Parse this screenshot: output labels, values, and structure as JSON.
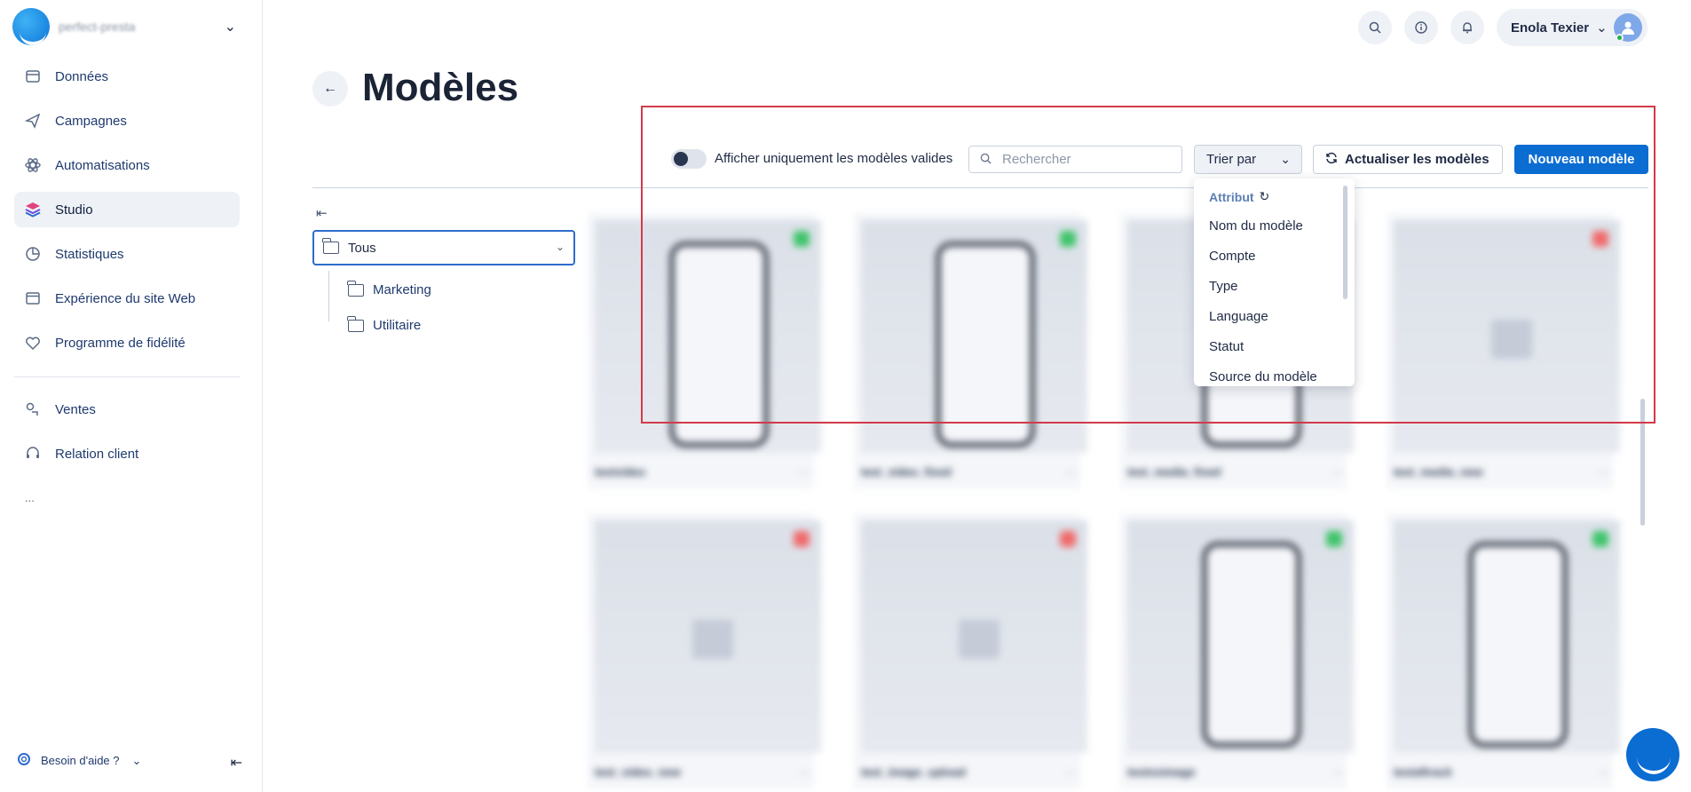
{
  "sidebar": {
    "brand_name": "perfect-presta",
    "items": [
      {
        "label": "Données",
        "icon": "database-icon"
      },
      {
        "label": "Campagnes",
        "icon": "paper-plane-icon"
      },
      {
        "label": "Automatisations",
        "icon": "atom-icon"
      },
      {
        "label": "Studio",
        "icon": "layers-icon",
        "active": true
      },
      {
        "label": "Statistiques",
        "icon": "pie-chart-icon"
      },
      {
        "label": "Expérience du site Web",
        "icon": "browser-window-icon"
      },
      {
        "label": "Programme de fidélité",
        "icon": "heart-tag-icon"
      },
      {
        "label": "Ventes",
        "icon": "sales-icon"
      },
      {
        "label": "Relation client",
        "icon": "headset-icon"
      }
    ],
    "more": "...",
    "help_label": "Besoin d'aide ?"
  },
  "header": {
    "user_name": "Enola Texier"
  },
  "page": {
    "title": "Modèles"
  },
  "toolbar": {
    "toggle_label": "Afficher uniquement les modèles valides",
    "toggle_on": false,
    "search_placeholder": "Rechercher",
    "search_value": "",
    "sort_label": "Trier par",
    "refresh_label": "Actualiser les modèles",
    "new_label": "Nouveau modèle"
  },
  "sort_dropdown": {
    "header": "Attribut",
    "options": [
      "Nom du modèle",
      "Compte",
      "Type",
      "Language",
      "Statut",
      "Source du modèle"
    ]
  },
  "folders": {
    "selected": "Tous",
    "children": [
      "Marketing",
      "Utilitaire"
    ]
  },
  "templates": [
    {
      "name": "testvideo",
      "status_color": "#3fc46a",
      "preview": "phone"
    },
    {
      "name": "test_video_fixed",
      "status_color": "#3fc46a",
      "preview": "phone"
    },
    {
      "name": "test_media_fixed",
      "status_color": "#3fc46a",
      "preview": "phone"
    },
    {
      "name": "test_media_new",
      "status_color": "#f06a6a",
      "preview": "image"
    },
    {
      "name": "test_video_new",
      "status_color": "#f06a6a",
      "preview": "image"
    },
    {
      "name": "test_image_upload",
      "status_color": "#f06a6a",
      "preview": "image"
    },
    {
      "name": "testnoimage",
      "status_color": "#3fc46a",
      "preview": "phone"
    },
    {
      "name": "testaftrack",
      "status_color": "#3fc46a",
      "preview": "phone"
    }
  ],
  "colors": {
    "primary": "#0b6cd1",
    "highlight_border": "#d23a4a",
    "active_nav_bg": "#eef1f6"
  }
}
